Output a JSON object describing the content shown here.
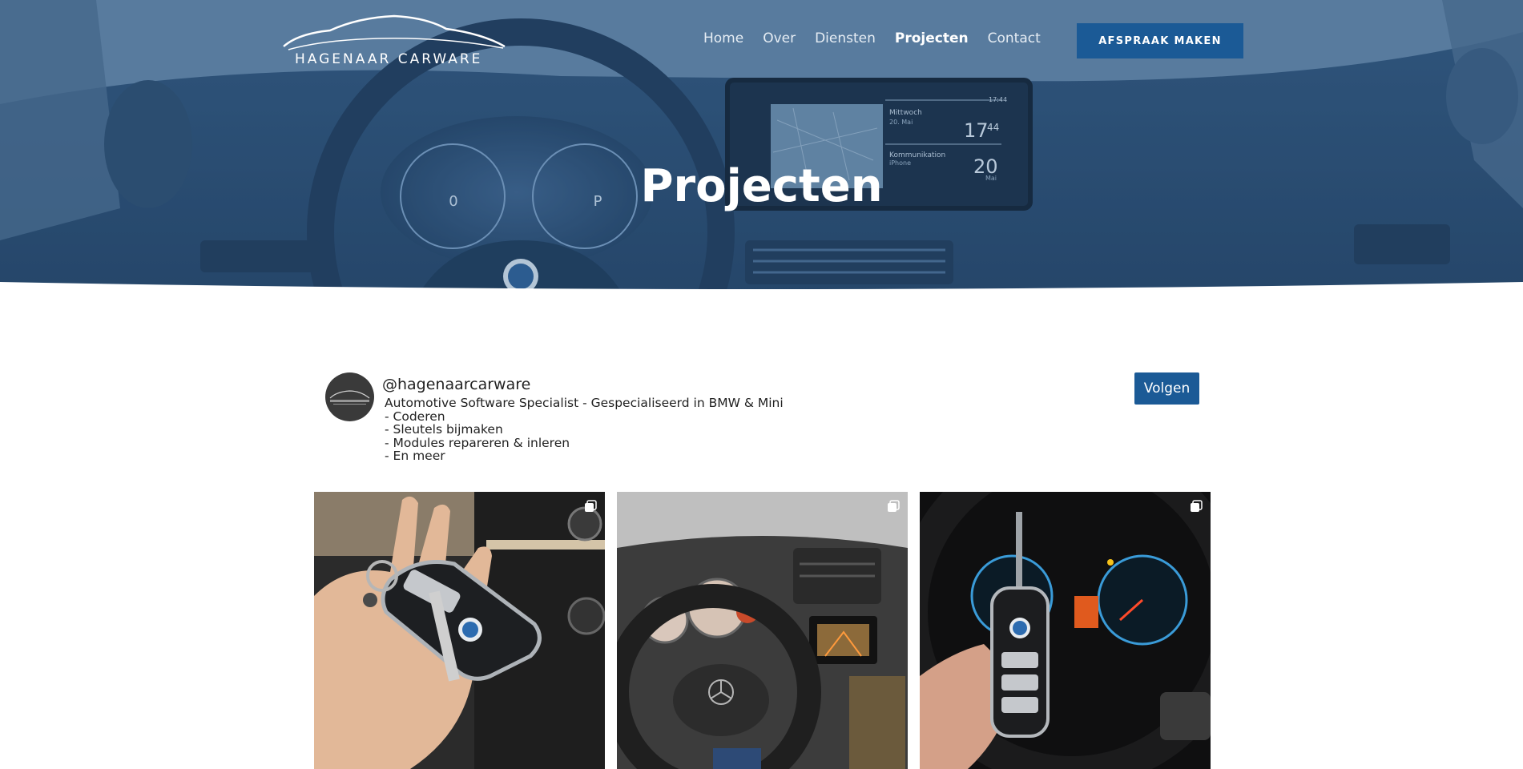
{
  "brand": {
    "name": "HAGENAAR CARWARE"
  },
  "nav": {
    "items": [
      {
        "label": "Home",
        "active": false
      },
      {
        "label": "Over",
        "active": false
      },
      {
        "label": "Diensten",
        "active": false
      },
      {
        "label": "Projecten",
        "active": true
      },
      {
        "label": "Contact",
        "active": false
      }
    ],
    "cta_label": "AFSPRAAK MAKEN"
  },
  "hero": {
    "title": "Projecten",
    "screen": {
      "day": "Mittwoch",
      "date": "20. Mai",
      "time_hours": "17",
      "time_minutes": "44",
      "status_time": "17:44",
      "section": "Kommunikation",
      "device": "iPhone",
      "calendar_day": "20",
      "calendar_month": "Mai"
    },
    "cluster": {
      "speed": "0",
      "gear": "P"
    }
  },
  "profile": {
    "handle": "@hagenaarcarware",
    "bio": [
      "Automotive Software Specialist - Gespecialiseerd in BMW & Mini",
      "- Coderen",
      "- Sleutels bijmaken",
      "- Modules repareren & inleren",
      "- En meer"
    ],
    "follow_label": "Volgen"
  },
  "posts": [
    {
      "subject": "bmw-key-in-hand",
      "multi": true
    },
    {
      "subject": "mercedes-dashboard",
      "multi": true
    },
    {
      "subject": "bmw-flip-key-cluster",
      "multi": true
    }
  ],
  "colors": {
    "accent": "#1b5a96",
    "hero_overlay": "#3e6489",
    "text": "#222222"
  }
}
